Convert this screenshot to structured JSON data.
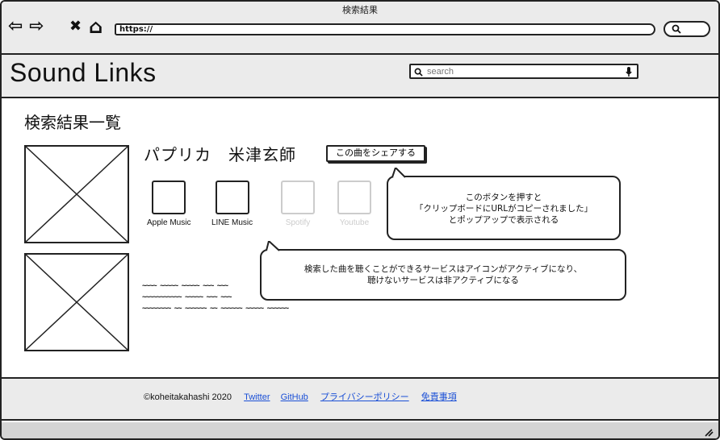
{
  "window": {
    "title": "検索結果"
  },
  "nav": {
    "back_icon": "⇦",
    "forward_icon": "⇨",
    "close_icon": "✖",
    "home_icon": "⌂",
    "url": "https://",
    "search_icon": "🔍"
  },
  "header": {
    "logo": "Sound Links",
    "search_placeholder": "search"
  },
  "main": {
    "title": "検索結果一覧",
    "song": {
      "title": "パプリカ　米津玄師",
      "share_label": "この曲をシェアする"
    },
    "services": [
      {
        "label": "Apple Music",
        "active": true
      },
      {
        "label": "LINE Music",
        "active": true
      },
      {
        "label": "Spotify",
        "active": false
      },
      {
        "label": "Youtube",
        "active": false
      }
    ],
    "bubble_share": {
      "line1": "このボタンを押すと",
      "line2": "「クリップボードにURLがコピーされました」",
      "line3": "とポップアップで表示される"
    },
    "bubble_services": {
      "line1": "検索した曲を聴くことができるサービスはアイコンがアクティブになり、",
      "line2": "聴けないサービスは非アクティブになる"
    },
    "placeholder_text": [
      "~~~~ ~~~~~ ~~~~~ ~~~ ~~~",
      "~~~~~~~~~~~ ~~~~~ ~~~ ~~~",
      "~~~~~~~~ ~~ ~~~~~~ ~~ ~~~~~~ ~~~~~ ~~~~~~"
    ]
  },
  "footer": {
    "copyright": "©koheitakahashi 2020",
    "links": [
      "Twitter",
      "GitHub",
      "プライバシーポリシー",
      "免責事項"
    ]
  }
}
